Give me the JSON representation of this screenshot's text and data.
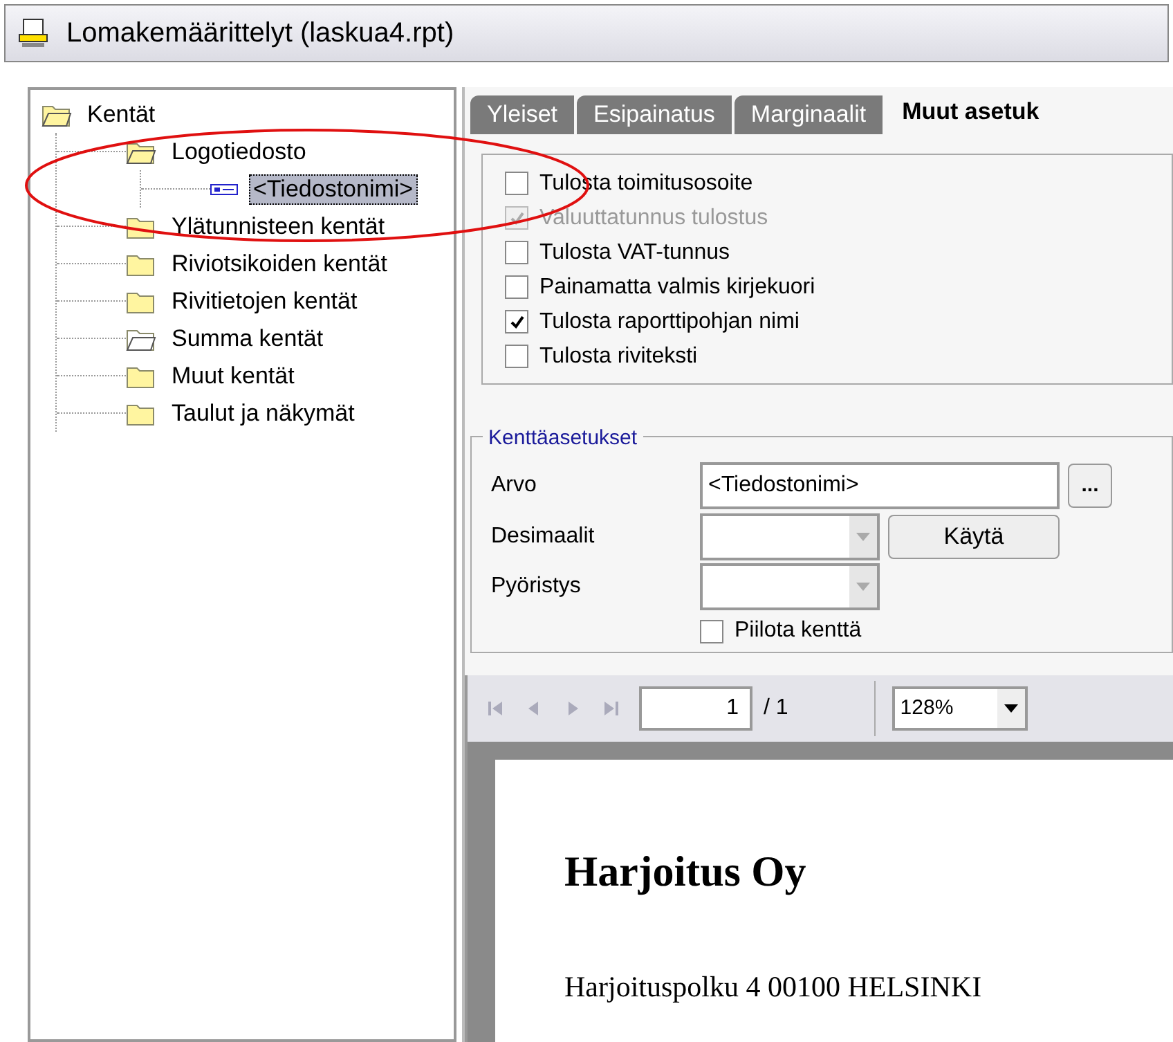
{
  "window": {
    "title": "Lomakemäärittelyt (laskua4.rpt)"
  },
  "tree": {
    "items": [
      {
        "label": "Kentät",
        "kind": "folder_open",
        "selected": false,
        "children": [
          {
            "label": "Logotiedosto",
            "kind": "folder_open",
            "selected": false,
            "children": [
              {
                "label": "<Tiedostonimi>",
                "kind": "field",
                "selected": true
              }
            ]
          },
          {
            "label": "Ylätunnisteen kentät",
            "kind": "folder",
            "selected": false
          },
          {
            "label": "Riviotsikoiden kentät",
            "kind": "folder",
            "selected": false
          },
          {
            "label": "Rivitietojen kentät",
            "kind": "folder",
            "selected": false
          },
          {
            "label": "Summa kentät",
            "kind": "folder_empty",
            "selected": false
          },
          {
            "label": "Muut kentät",
            "kind": "folder",
            "selected": false
          },
          {
            "label": "Taulut ja näkymät",
            "kind": "folder",
            "selected": false
          }
        ]
      }
    ]
  },
  "tabs": [
    {
      "label": "Yleiset",
      "selected": false
    },
    {
      "label": "Esipainatus",
      "selected": false
    },
    {
      "label": "Marginaalit",
      "selected": false
    },
    {
      "label": "Muut asetuk",
      "selected": true
    }
  ],
  "options": [
    {
      "label": "Tulosta toimitusosoite",
      "checked": false,
      "disabled": false
    },
    {
      "label": "Valuuttatunnus tulostus",
      "checked": true,
      "disabled": true
    },
    {
      "label": "Tulosta VAT-tunnus",
      "checked": false,
      "disabled": false
    },
    {
      "label": "Painamatta valmis kirjekuori",
      "checked": false,
      "disabled": false
    },
    {
      "label": "Tulosta raporttipohjan nimi",
      "checked": true,
      "disabled": false
    },
    {
      "label": "Tulosta riviteksti",
      "checked": false,
      "disabled": false
    }
  ],
  "field_settings": {
    "title": "Kenttäasetukset",
    "value_label": "Arvo",
    "value": "<Tiedostonimi>",
    "browse_button": "...",
    "decimals_label": "Desimaalit",
    "apply_button": "Käytä",
    "rounding_label": "Pyöristys",
    "hide_field": {
      "label": "Piilota kenttä",
      "checked": false
    }
  },
  "preview": {
    "page": "1",
    "page_total": "/ 1",
    "zoom": "128%",
    "company": "Harjoitus Oy",
    "address": "Harjoituspolku 4 00100 HELSINKI"
  }
}
